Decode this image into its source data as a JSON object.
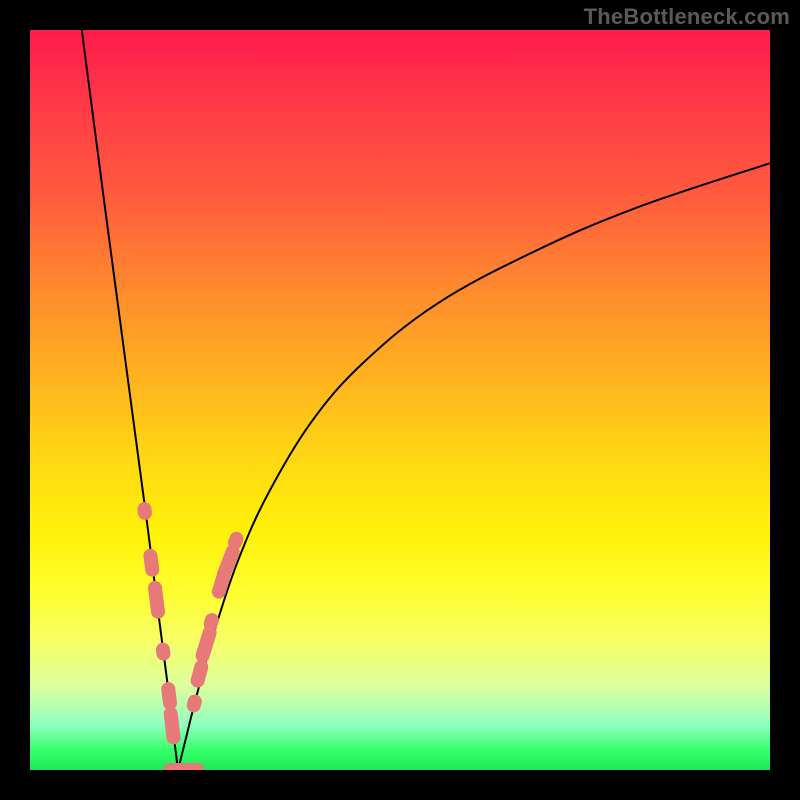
{
  "watermark": "TheBottleneck.com",
  "colors": {
    "background": "#000000",
    "grad_top": "#ff1a4d",
    "grad_bottom": "#21e657",
    "curve": "#000000",
    "marker": "#e77a78"
  },
  "chart_data": {
    "type": "line",
    "title": "",
    "xlabel": "",
    "ylabel": "",
    "xlim": [
      0,
      100
    ],
    "ylim": [
      0,
      100
    ],
    "legend": false,
    "grid": false,
    "note": "Axis-less bottleneck V curve. x is a hidden performance ratio, y≈bottleneck %. Minimum is at x≈20. Values estimated from pixels.",
    "series": [
      {
        "name": "left-branch",
        "x": [
          7,
          10,
          12,
          14,
          16,
          17.5,
          18.8,
          19.5,
          20
        ],
        "values": [
          100,
          77,
          62,
          47,
          32,
          20,
          10,
          4,
          0
        ]
      },
      {
        "name": "right-branch",
        "x": [
          20,
          21,
          22.5,
          25,
          28,
          32,
          38,
          45,
          55,
          68,
          82,
          100
        ],
        "values": [
          0,
          4,
          10,
          19,
          28,
          37,
          47,
          55,
          63,
          70,
          76,
          82
        ]
      }
    ],
    "markers": {
      "comment": "pink capsule markers along both branches near the minimum",
      "left": [
        {
          "x": 15.5,
          "y": 35
        },
        {
          "x": 16.4,
          "y": 28
        },
        {
          "x": 17.1,
          "y": 23
        },
        {
          "x": 18.0,
          "y": 16
        },
        {
          "x": 18.8,
          "y": 10
        },
        {
          "x": 19.2,
          "y": 6
        }
      ],
      "right": [
        {
          "x": 22.2,
          "y": 9
        },
        {
          "x": 22.9,
          "y": 13
        },
        {
          "x": 23.8,
          "y": 17
        },
        {
          "x": 24.5,
          "y": 20
        },
        {
          "x": 25.8,
          "y": 25
        },
        {
          "x": 26.8,
          "y": 28
        },
        {
          "x": 27.8,
          "y": 31
        }
      ],
      "bottom": [
        {
          "x": 19.8,
          "y": 0
        },
        {
          "x": 20.8,
          "y": 0
        },
        {
          "x": 21.8,
          "y": 0
        }
      ]
    }
  }
}
